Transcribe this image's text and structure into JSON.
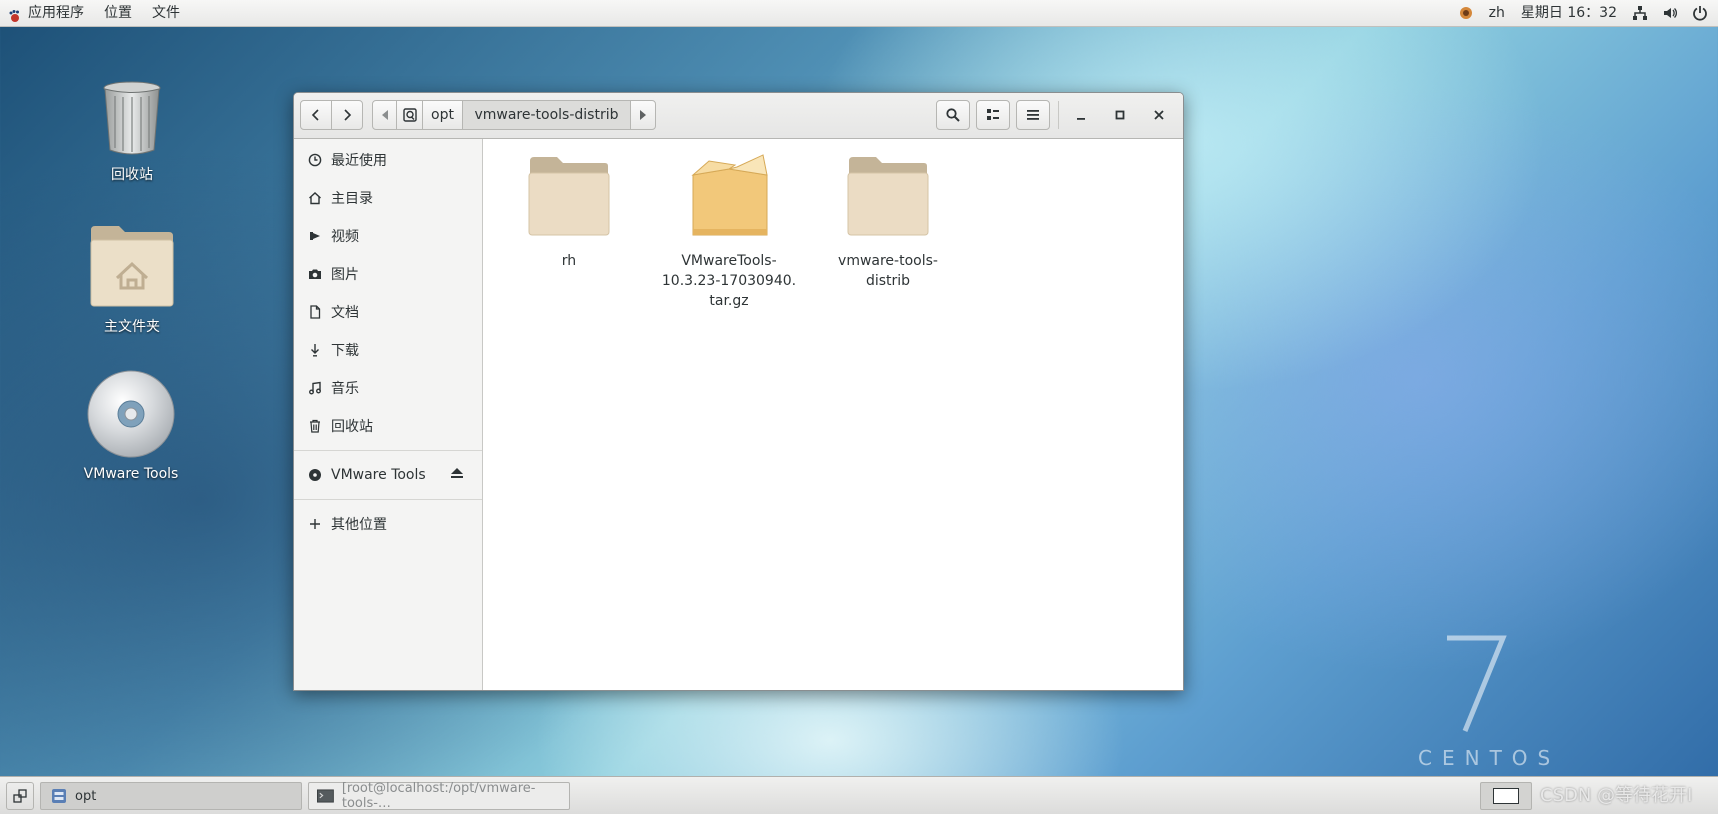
{
  "top_panel": {
    "apps_label": "应用程序",
    "places_label": "位置",
    "file_label": "文件",
    "lang": "zh",
    "clock": "星期日 16：32"
  },
  "desktop": {
    "trash_label": "回收站",
    "home_label": "主文件夹",
    "vmware_label": "VMware Tools"
  },
  "window": {
    "path": [
      "opt",
      "vmware-tools-distrib"
    ],
    "sidebar": {
      "items": [
        {
          "label": "最近使用",
          "icon": "clock-icon"
        },
        {
          "label": "主目录",
          "icon": "home-icon"
        },
        {
          "label": "视频",
          "icon": "video-icon"
        },
        {
          "label": "图片",
          "icon": "camera-icon"
        },
        {
          "label": "文档",
          "icon": "document-icon"
        },
        {
          "label": "下载",
          "icon": "download-icon"
        },
        {
          "label": "音乐",
          "icon": "music-icon"
        },
        {
          "label": "回收站",
          "icon": "trash-icon"
        }
      ],
      "device_label": "VMware Tools",
      "other_label": "其他位置"
    },
    "files": [
      {
        "name": "rh",
        "type": "folder"
      },
      {
        "name_lines": [
          "VMwareTools-",
          "10.3.23-17030940.",
          "tar.gz"
        ],
        "type": "archive"
      },
      {
        "name": "vmware-tools-distrib",
        "type": "folder"
      }
    ]
  },
  "taskbar": {
    "task1_label": "opt",
    "task2_label": "[root@localhost:/opt/vmware-tools-…"
  },
  "watermark": {
    "centos_number": "7",
    "centos_text": "CENTOS",
    "csdn_text": "CSDN @等待花开I"
  },
  "colors": {
    "folder_tab": "#c4b498",
    "folder_body": "#e9dcc5",
    "archive": "#f0c878"
  }
}
